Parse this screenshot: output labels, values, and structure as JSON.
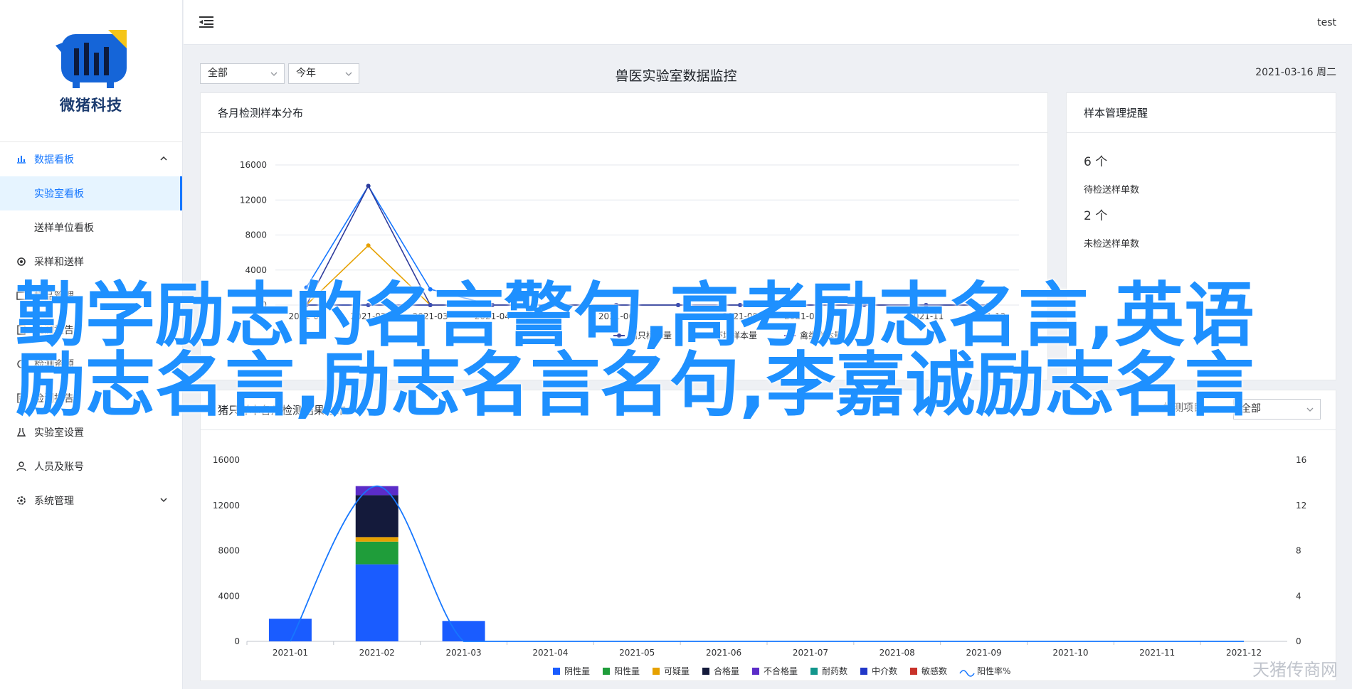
{
  "logo": {
    "text": "微猪科技"
  },
  "menu": {
    "items": [
      {
        "label": "数据看板",
        "icon": "bar-chart-icon",
        "open": true,
        "children": [
          {
            "label": "实验室看板",
            "active": true
          },
          {
            "label": "送样单位看板"
          }
        ]
      },
      {
        "label": "采样和送样",
        "icon": "gear-icon"
      },
      {
        "label": "样品管理",
        "icon": "box-icon"
      },
      {
        "label": "检测报告",
        "icon": "report-icon"
      },
      {
        "label": "检测资源",
        "icon": "resource-icon"
      },
      {
        "label": "检测报告",
        "icon": "doc-icon"
      },
      {
        "label": "实验室设置",
        "icon": "lab-icon"
      },
      {
        "label": "人员及账号",
        "icon": "user-icon"
      },
      {
        "label": "系统管理",
        "icon": "settings-icon"
      }
    ]
  },
  "header": {
    "user": "test",
    "fold_icon": "menu-fold-icon"
  },
  "filters": {
    "scope": "全部",
    "period": "今年"
  },
  "dashboard": {
    "title": "兽医实验室数据监控",
    "date": "2021-03-16 周二"
  },
  "card_monthly": {
    "title": "各月检测样本分布"
  },
  "card_reminder": {
    "title": "样本管理提醒",
    "pending_value": "6 个",
    "pending_label": "待检送样单数",
    "unsent_value": "2 个",
    "unsent_label": "未检送样单数"
  },
  "card_results": {
    "title": "猪只样本各月检测结果分布",
    "filter_label": "检测项目",
    "filter": "全部"
  },
  "overlay_caption": {
    "line1": "勤学励志的名言警句,高考励志名言,英语",
    "line2": "励志名言,励志名言名句,李嘉诚励志名言"
  },
  "watermark": "天猪传商网",
  "chart_data": [
    {
      "type": "line",
      "title": "各月检测样本分布",
      "categories": [
        "2021-01",
        "2021-02",
        "2021-03",
        "2021-04",
        "2021-05",
        "2021-06",
        "2021-07",
        "2021-08",
        "2021-09",
        "2021-10",
        "2021-11",
        "2021-12"
      ],
      "visible_tick_labels": [
        "2021-01",
        "2021-02",
        "2021-03",
        "2021-04",
        "2021-06",
        "2021-08",
        "2021-09",
        "2021-11",
        "2021-12"
      ],
      "ylim": [
        0,
        16000
      ],
      "yticks": [
        0,
        4000,
        8000,
        12000,
        16000
      ],
      "series": [
        {
          "name": "",
          "color": "#1677ff",
          "values": [
            2000,
            13600,
            1800,
            0,
            0,
            0,
            0,
            0,
            0,
            0,
            0,
            0
          ]
        },
        {
          "name": "猪只样本量",
          "color": "#2f3c9c",
          "values": [
            0,
            13600,
            0,
            0,
            0,
            0,
            0,
            0,
            0,
            0,
            0,
            0
          ]
        },
        {
          "name": "",
          "color": "#19a64a",
          "values": [
            0,
            0,
            0,
            0,
            0,
            0,
            0,
            0,
            0,
            0,
            0,
            0
          ]
        },
        {
          "name": "环境样本量",
          "color": "#e6a100",
          "values": [
            0,
            6800,
            0,
            0,
            0,
            0,
            0,
            0,
            0,
            0,
            0,
            0
          ]
        },
        {
          "name": "禽类样本量",
          "color": "#5b2ca8",
          "values": [
            0,
            0,
            0,
            0,
            0,
            0,
            0,
            0,
            0,
            0,
            0,
            0
          ]
        },
        {
          "name": "",
          "color": "#3a4fb5",
          "values": [
            0,
            0,
            0,
            0,
            0,
            0,
            0,
            0,
            0,
            0,
            0,
            0
          ]
        }
      ],
      "grid": true
    },
    {
      "type": "bar",
      "title": "猪只样本各月检测结果分布",
      "categories": [
        "2021-01",
        "2021-02",
        "2021-03",
        "2021-04",
        "2021-05",
        "2021-06",
        "2021-07",
        "2021-08",
        "2021-09",
        "2021-10",
        "2021-11",
        "2021-12"
      ],
      "ylim": [
        0,
        16000
      ],
      "yticks": [
        0,
        4000,
        8000,
        12000,
        16000
      ],
      "y2lim": [
        0,
        16
      ],
      "y2ticks": [
        0,
        4,
        8,
        12,
        16
      ],
      "stacked": true,
      "series": [
        {
          "name": "阴性量",
          "color": "#1a5cff",
          "values": [
            2000,
            6800,
            1800,
            0,
            0,
            0,
            0,
            0,
            0,
            0,
            0,
            0
          ]
        },
        {
          "name": "阳性量",
          "color": "#1f9d3a",
          "values": [
            0,
            2000,
            0,
            0,
            0,
            0,
            0,
            0,
            0,
            0,
            0,
            0
          ]
        },
        {
          "name": "可疑量",
          "color": "#e6a100",
          "values": [
            0,
            400,
            0,
            0,
            0,
            0,
            0,
            0,
            0,
            0,
            0,
            0
          ]
        },
        {
          "name": "合格量",
          "color": "#141a3b",
          "values": [
            0,
            3700,
            0,
            0,
            0,
            0,
            0,
            0,
            0,
            0,
            0,
            0
          ]
        },
        {
          "name": "不合格量",
          "color": "#5b2cc8",
          "values": [
            0,
            800,
            0,
            0,
            0,
            0,
            0,
            0,
            0,
            0,
            0,
            0
          ]
        },
        {
          "name": "耐药数",
          "color": "#12968c",
          "values": [
            0,
            0,
            0,
            0,
            0,
            0,
            0,
            0,
            0,
            0,
            0,
            0
          ]
        },
        {
          "name": "中介数",
          "color": "#2238c8",
          "values": [
            0,
            0,
            0,
            0,
            0,
            0,
            0,
            0,
            0,
            0,
            0,
            0
          ]
        },
        {
          "name": "敏感数",
          "color": "#c8322a",
          "values": [
            0,
            0,
            0,
            0,
            0,
            0,
            0,
            0,
            0,
            0,
            0,
            0
          ]
        }
      ],
      "line_series": {
        "name": "阳性率%",
        "color": "#1677ff",
        "axis": "right",
        "values": [
          0,
          13.7,
          0,
          0,
          0,
          0,
          0,
          0,
          0,
          0,
          0,
          0
        ]
      },
      "legend": "bottom",
      "grid": false
    }
  ]
}
